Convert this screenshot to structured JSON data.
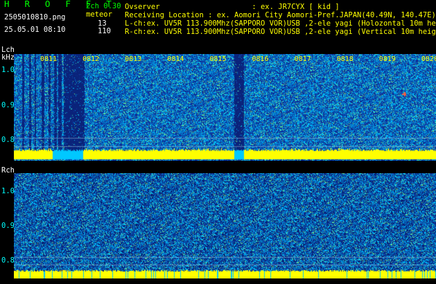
{
  "header": {
    "title": "H R O F F T",
    "channel_mode": "2ch 0.30",
    "filename": "2505010810.png",
    "datetime": "25.05.01 08:10",
    "meteor_label": "meteor",
    "meteor_lch_count": "13",
    "meteor_rch_count": "110",
    "observer": "Ovserver                     : ex. JR7CYX [ kid ]",
    "location": "Receiving Location : ex. Aomori City Aomori-Pref.JAPAN(40.49N, 140.47E)",
    "lch_info": "L-ch:ex. UV5R 113.900Mhz(SAPPORO VOR)USB ,2-ele yagi (Holozontal 10m height)",
    "rch_info": "R-ch:ex. UV5R 113.900Mhz(SAPPORO VOR)USB ,2-ele yagi (Vertical 10m height)"
  },
  "lch": {
    "label": "Lch",
    "unit": "kHz",
    "y_ticks": [
      "1.0",
      "0.9",
      "0.8"
    ]
  },
  "rch": {
    "label": "Rch",
    "y_ticks": [
      "1.0",
      "0.9",
      "0.8"
    ]
  },
  "time_ticks": [
    "0811",
    "0812",
    "0813",
    "0814",
    "0815",
    "0816",
    "0817",
    "0818",
    "0819",
    "0820"
  ],
  "colors": {
    "background": "#000000",
    "title": "#00ff00",
    "text": "#ffff00",
    "waterfall_low": "#0b2f8a",
    "waterfall_high": "#00c8ff",
    "carrier": "#ffff00"
  }
}
